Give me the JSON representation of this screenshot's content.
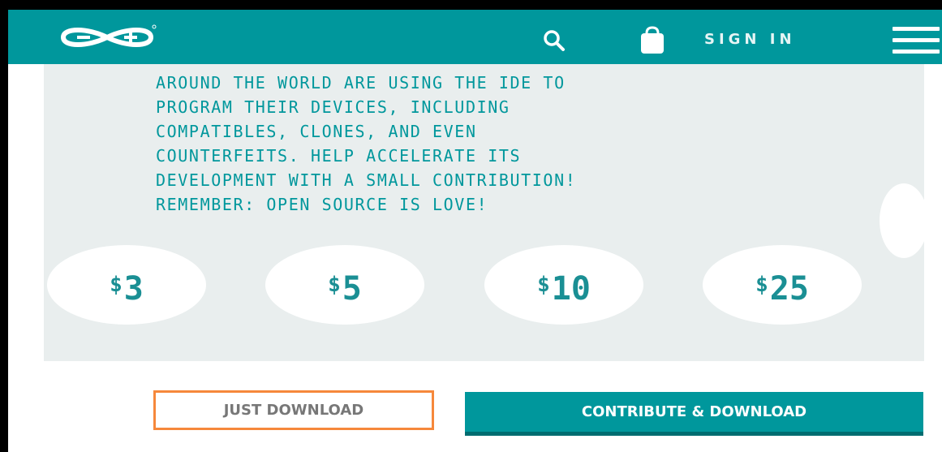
{
  "header": {
    "logo_icon": "arduino-infinity-logo",
    "search_icon": "search-icon",
    "cart_icon": "shopping-bag-icon",
    "sign_in_label": "SIGN IN",
    "menu_icon": "hamburger-menu-icon"
  },
  "donation": {
    "message_lines": [
      "AROUND THE WORLD ARE USING THE IDE TO",
      "PROGRAM THEIR DEVICES, INCLUDING",
      "COMPATIBLES, CLONES, AND EVEN",
      "COUNTERFEITS. HELP ACCELERATE ITS",
      "DEVELOPMENT WITH A SMALL CONTRIBUTION!",
      "REMEMBER: OPEN SOURCE IS LOVE!"
    ],
    "currency_symbol": "$",
    "amounts": [
      "3",
      "5",
      "10",
      "25"
    ]
  },
  "actions": {
    "just_download_label": "JUST DOWNLOAD",
    "contribute_download_label": "CONTRIBUTE & DOWNLOAD"
  },
  "colors": {
    "brand_teal": "#00979c",
    "highlight_orange": "#f6883b",
    "panel_gray": "#e9eeee"
  }
}
